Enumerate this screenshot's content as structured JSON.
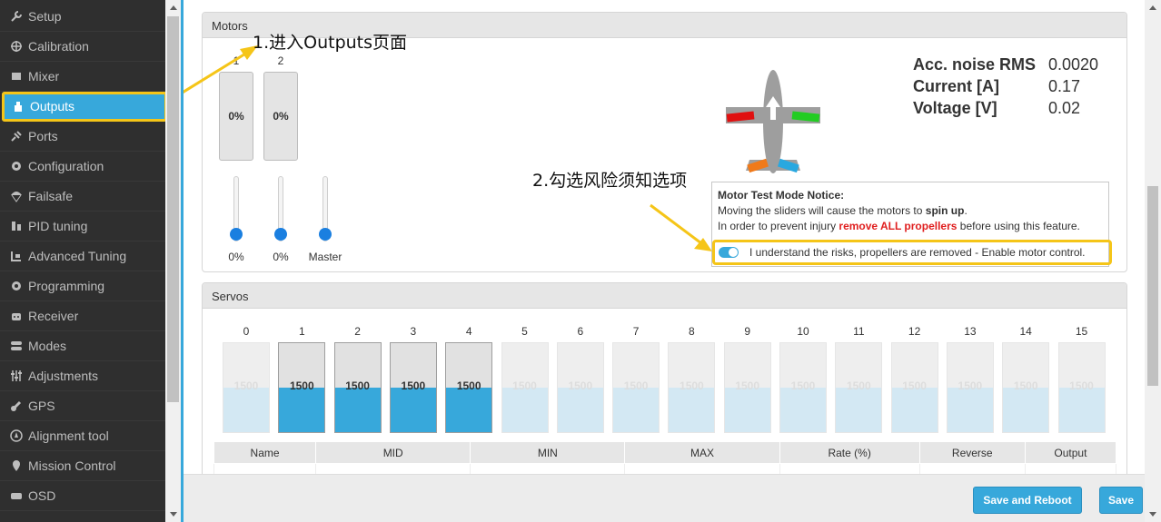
{
  "sidebar": {
    "items": [
      {
        "label": "Setup",
        "icon": "wrench-icon"
      },
      {
        "label": "Calibration",
        "icon": "crosshair-icon"
      },
      {
        "label": "Mixer",
        "icon": "mixer-icon"
      },
      {
        "label": "Outputs",
        "icon": "motor-icon",
        "active": true
      },
      {
        "label": "Ports",
        "icon": "plug-icon"
      },
      {
        "label": "Configuration",
        "icon": "gear-icon"
      },
      {
        "label": "Failsafe",
        "icon": "parachute-icon"
      },
      {
        "label": "PID tuning",
        "icon": "pid-icon"
      },
      {
        "label": "Advanced Tuning",
        "icon": "advanced-tuning-icon"
      },
      {
        "label": "Programming",
        "icon": "gear-icon"
      },
      {
        "label": "Receiver",
        "icon": "robot-icon"
      },
      {
        "label": "Modes",
        "icon": "toggles-icon"
      },
      {
        "label": "Adjustments",
        "icon": "sliders-icon"
      },
      {
        "label": "GPS",
        "icon": "satellite-icon"
      },
      {
        "label": "Alignment tool",
        "icon": "compass-icon"
      },
      {
        "label": "Mission Control",
        "icon": "map-marker-icon"
      },
      {
        "label": "OSD",
        "icon": "osd-icon"
      }
    ]
  },
  "motors": {
    "title": "Motors",
    "channels": [
      {
        "number": "1",
        "value": "0%",
        "slider_label": "0%",
        "level": 0
      },
      {
        "number": "2",
        "value": "0%",
        "slider_label": "0%",
        "level": 0
      }
    ],
    "master_label": "Master",
    "stats": [
      {
        "label": "Acc. noise RMS",
        "value": "0.0020"
      },
      {
        "label": "Current [A]",
        "value": "0.17"
      },
      {
        "label": "Voltage [V]",
        "value": "0.02"
      }
    ],
    "notice": {
      "title": "Motor Test Mode Notice:",
      "line1_prefix": "Moving the sliders will cause the motors to ",
      "line1_bold": "spin up",
      "line1_suffix": ".",
      "line2_prefix": "In order to prevent injury ",
      "line2_red": "remove ALL propellers",
      "line2_suffix": " before using this feature.",
      "toggle_label": "I understand the risks, propellers are removed - Enable motor control.",
      "toggle_on": true
    }
  },
  "servos": {
    "title": "Servos",
    "channels": [
      {
        "number": "0",
        "value": "1500",
        "active": false
      },
      {
        "number": "1",
        "value": "1500",
        "active": true
      },
      {
        "number": "2",
        "value": "1500",
        "active": true
      },
      {
        "number": "3",
        "value": "1500",
        "active": true
      },
      {
        "number": "4",
        "value": "1500",
        "active": true
      },
      {
        "number": "5",
        "value": "1500",
        "active": false
      },
      {
        "number": "6",
        "value": "1500",
        "active": false
      },
      {
        "number": "7",
        "value": "1500",
        "active": false
      },
      {
        "number": "8",
        "value": "1500",
        "active": false
      },
      {
        "number": "9",
        "value": "1500",
        "active": false
      },
      {
        "number": "10",
        "value": "1500",
        "active": false
      },
      {
        "number": "11",
        "value": "1500",
        "active": false
      },
      {
        "number": "12",
        "value": "1500",
        "active": false
      },
      {
        "number": "13",
        "value": "1500",
        "active": false
      },
      {
        "number": "14",
        "value": "1500",
        "active": false
      },
      {
        "number": "15",
        "value": "1500",
        "active": false
      }
    ],
    "table_headers": [
      "Name",
      "MID",
      "MIN",
      "MAX",
      "Rate (%)",
      "Reverse",
      "Output"
    ]
  },
  "buttons": {
    "save_reboot": "Save and Reboot",
    "save": "Save"
  },
  "annotations": {
    "step1": "1.进入Outputs页面",
    "step2": "2.勾选风险须知选项"
  },
  "colors": {
    "accent": "#37a8db",
    "highlight": "#f5c518",
    "sidebar_bg": "#2f2f2f",
    "warning_red": "#e02020"
  }
}
